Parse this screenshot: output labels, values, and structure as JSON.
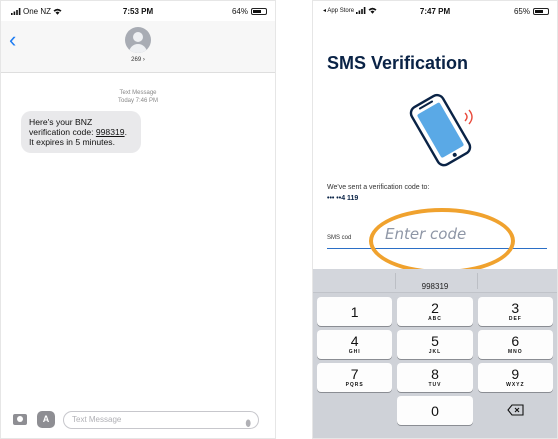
{
  "left": {
    "status": {
      "carrier": "One NZ",
      "time": "7:53 PM",
      "battery": "64%",
      "battery_level": 0.64
    },
    "header": {
      "back_icon": "chevron-left-icon",
      "contact": "269"
    },
    "meta": {
      "type": "Text Message",
      "timestamp": "Today 7:46 PM"
    },
    "message": {
      "prefix": "Here's your BNZ verification code: ",
      "code": "998319",
      "suffix": ". It expires in 5 minutes."
    },
    "compose": {
      "placeholder": "Text Message",
      "icons": [
        "camera-icon",
        "app-store-icon",
        "microphone-icon"
      ]
    }
  },
  "right": {
    "status": {
      "back_app": "◂ App Store",
      "time": "7:47 PM",
      "battery": "65%",
      "battery_level": 0.65
    },
    "title": "SMS Verification",
    "sent_text": "We've sent a verification code to:",
    "masked_number": "••• ••4 119",
    "code_label": "SMS cod",
    "input_placeholder": "Enter code",
    "keyboard": {
      "suggestion": "998319",
      "keys": [
        {
          "digit": "1",
          "letters": ""
        },
        {
          "digit": "2",
          "letters": "ABC"
        },
        {
          "digit": "3",
          "letters": "DEF"
        },
        {
          "digit": "4",
          "letters": "GHI"
        },
        {
          "digit": "5",
          "letters": "JKL"
        },
        {
          "digit": "6",
          "letters": "MNO"
        },
        {
          "digit": "7",
          "letters": "PQRS"
        },
        {
          "digit": "8",
          "letters": "TUV"
        },
        {
          "digit": "9",
          "letters": "WXYZ"
        },
        {
          "digit": "0",
          "letters": ""
        }
      ]
    },
    "colors": {
      "title": "#0a2346",
      "highlight": "#f0a22e",
      "accent": "#2b6fc6"
    }
  }
}
